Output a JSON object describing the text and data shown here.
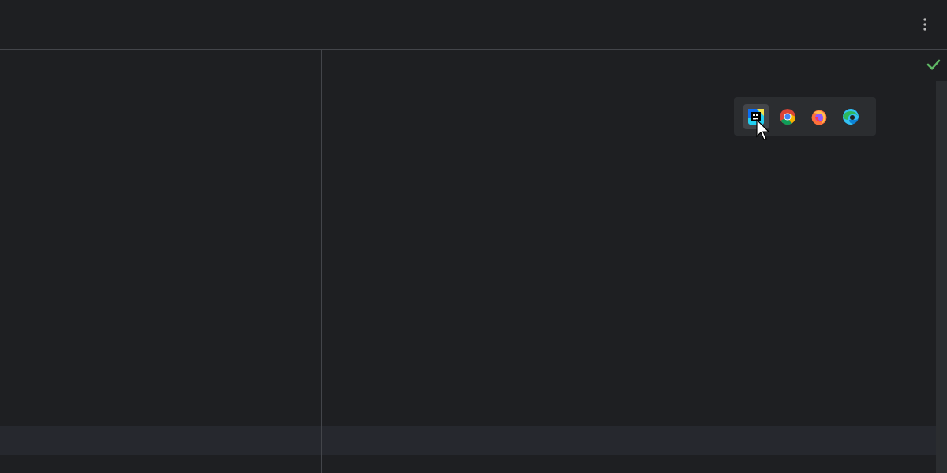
{
  "editor": {
    "no_problems": true
  },
  "browser_popup": {
    "buttons": [
      {
        "kind": "ide",
        "selected": true
      },
      {
        "kind": "chrome",
        "selected": false
      },
      {
        "kind": "firefox",
        "selected": false
      },
      {
        "kind": "edge",
        "selected": false
      }
    ]
  }
}
